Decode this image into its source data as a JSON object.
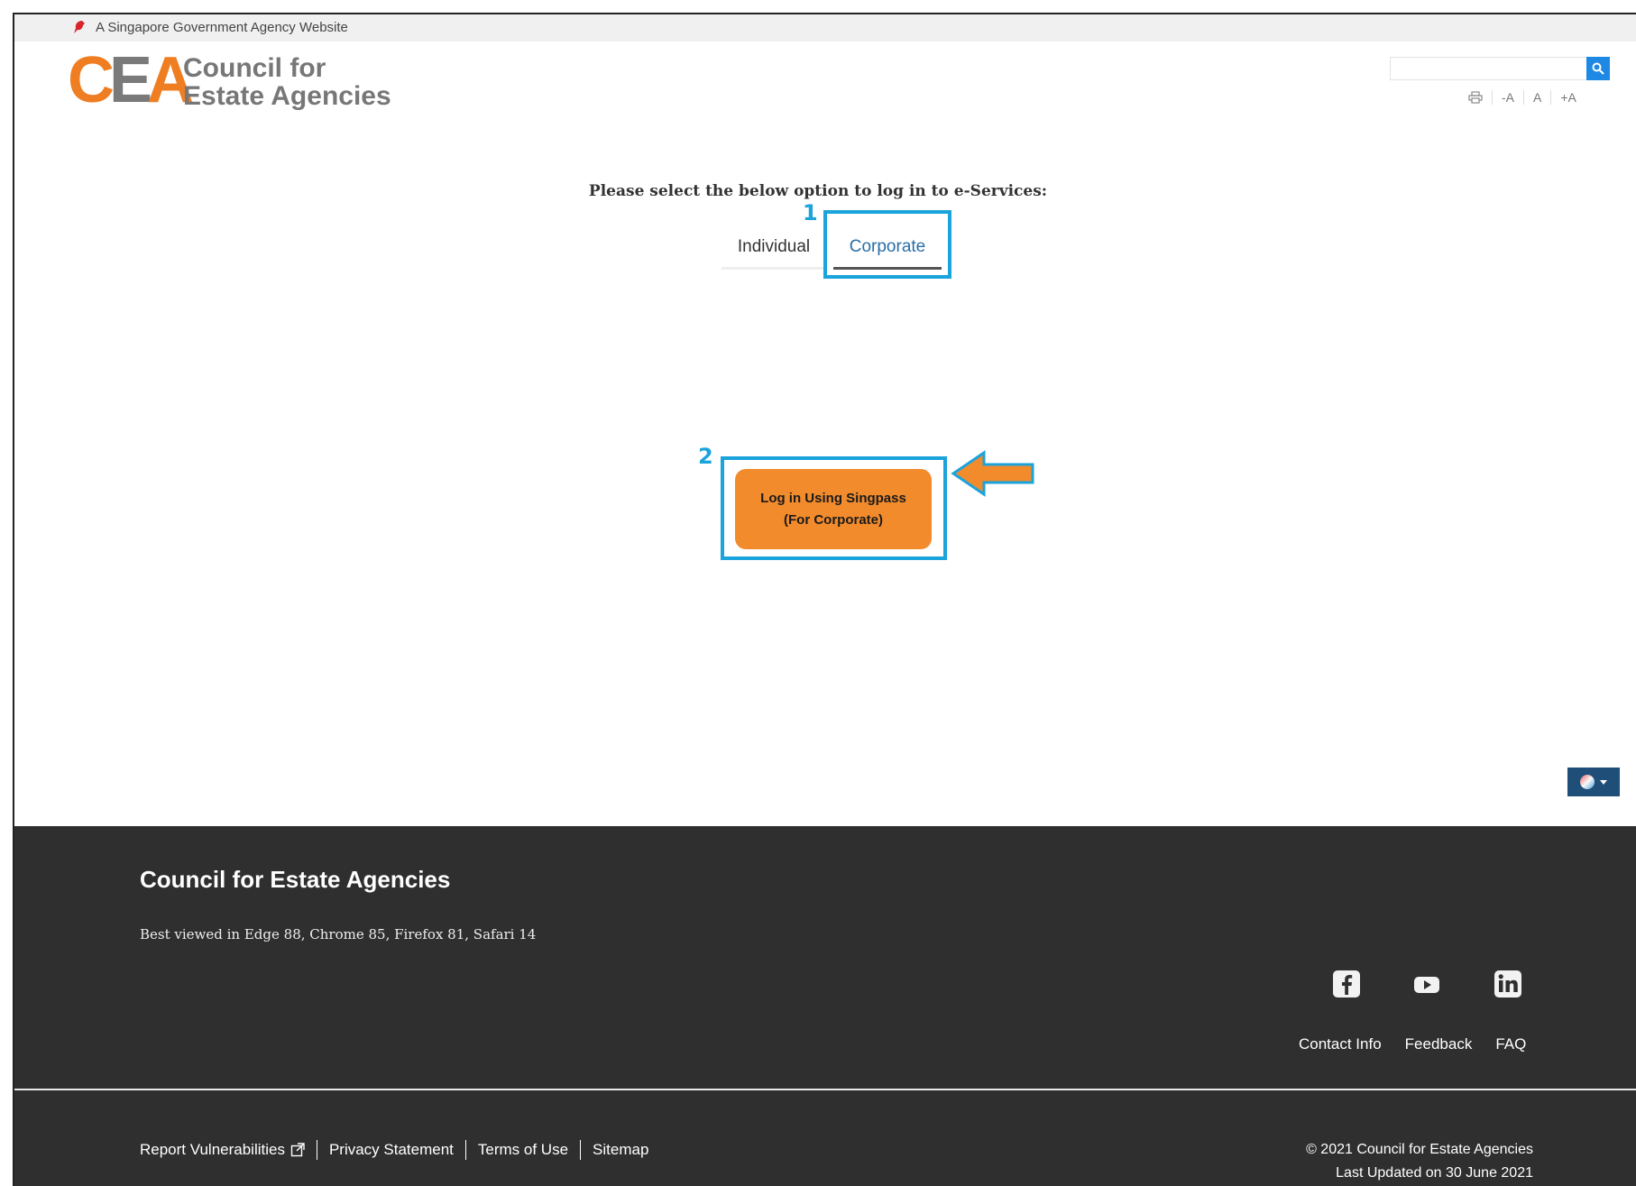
{
  "gov_bar": {
    "text": "A Singapore Government Agency Website"
  },
  "logo": {
    "line1": "Council for",
    "line2": "Estate Agencies",
    "mark_c": "C",
    "mark_e": "E",
    "mark_a": "A"
  },
  "header_tools": {
    "decrease": "-A",
    "reset": "A",
    "increase": "+A"
  },
  "login": {
    "prompt": "Please select the below option to log in to e-Services:",
    "tabs": [
      "Individual",
      "Corporate"
    ],
    "active_tab": "Corporate",
    "button_line1": "Log in Using Singpass",
    "button_line2": "(For Corporate)"
  },
  "callouts": {
    "one": "1",
    "two": "2"
  },
  "footer": {
    "title": "Council for Estate Agencies",
    "best_viewed": "Best viewed in Edge 88, Chrome 85, Firefox 81, Safari 14",
    "links": [
      "Contact Info",
      "Feedback",
      "FAQ"
    ],
    "bottom_links": [
      "Report Vulnerabilities",
      "Privacy Statement",
      "Terms of Use",
      "Sitemap"
    ],
    "copyright": "© 2021 Council for Estate Agencies",
    "updated": "Last Updated on 30 June 2021"
  },
  "colors": {
    "accent_orange": "#f28b2c",
    "callout_blue": "#1ba3dc",
    "footer_bg": "#2f2f2f",
    "tab_active": "#2a6ea8"
  },
  "icons": [
    "lion-icon",
    "search-icon",
    "print-icon",
    "globe-icon",
    "facebook-icon",
    "youtube-icon",
    "linkedin-icon",
    "external-link-icon"
  ]
}
